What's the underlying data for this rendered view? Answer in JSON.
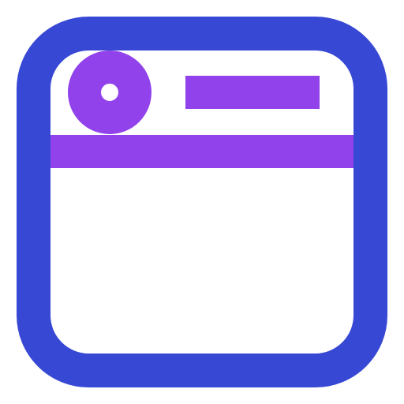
{
  "icon": {
    "name": "dishwasher-icon",
    "colors": {
      "frame": "#3748d4",
      "accent": "#9142eb",
      "background": "#ffffff"
    }
  }
}
